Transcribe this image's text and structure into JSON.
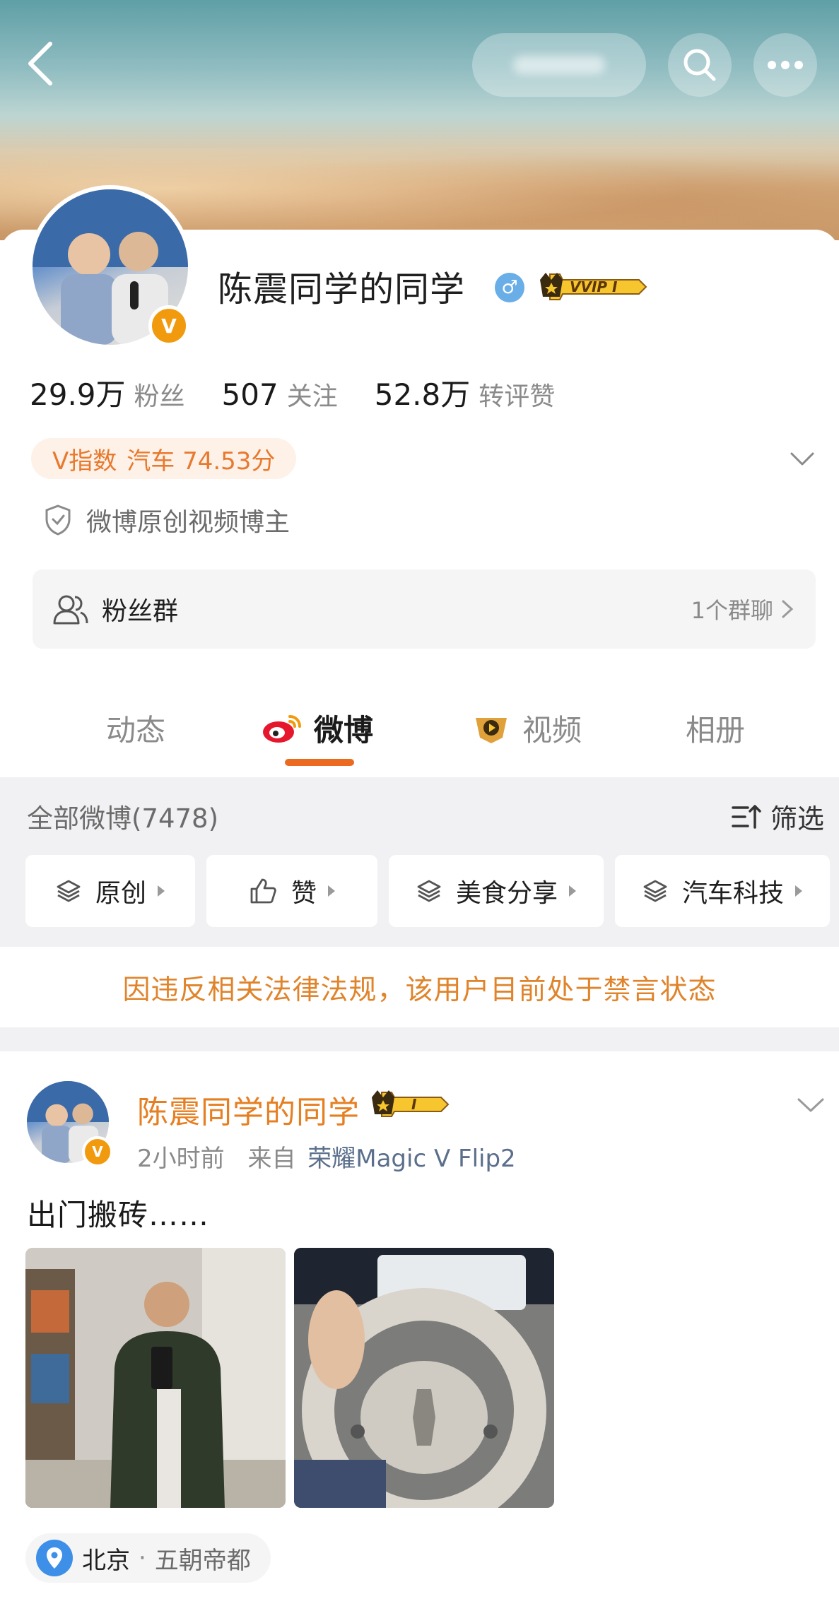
{
  "profile": {
    "name": "陈震同学的同学",
    "vip_label": "VVIP I",
    "verified_mark": "V",
    "gender_icon": "male-icon",
    "stats": [
      {
        "value": "29.9万",
        "label": "粉丝"
      },
      {
        "value": "507",
        "label": "关注"
      },
      {
        "value": "52.8万",
        "label": "转评赞"
      }
    ],
    "v_index": {
      "prefix": "V指数",
      "text": "汽车 74.53分"
    },
    "certification": "微博原创视频博主",
    "fan_group": {
      "label": "粉丝群",
      "count": "1个群聊"
    }
  },
  "tabs": [
    {
      "label": "动态",
      "icon": ""
    },
    {
      "label": "微博",
      "icon": "weibo-icon",
      "active": true
    },
    {
      "label": "视频",
      "icon": "video-icon"
    },
    {
      "label": "相册",
      "icon": ""
    }
  ],
  "feed": {
    "count_label": "全部微博(7478)",
    "filter_label": "筛选",
    "chips": [
      "原创",
      "赞",
      "美食分享",
      "汽车科技"
    ],
    "notice": "因违反相关法律法规，该用户目前处于禁言状态"
  },
  "post": {
    "author": "陈震同学的同学",
    "vip_label": "I",
    "time": "2小时前",
    "source_prefix": "来自",
    "source": "荣耀Magic V Flip2",
    "text": "出门搬砖……",
    "location": {
      "city": "北京",
      "desc": "五朝帝都"
    }
  },
  "colors": {
    "accent": "#ec6a1f",
    "notice": "#e0842b",
    "name_orange": "#e67f22",
    "badge": "#f29a0e"
  }
}
